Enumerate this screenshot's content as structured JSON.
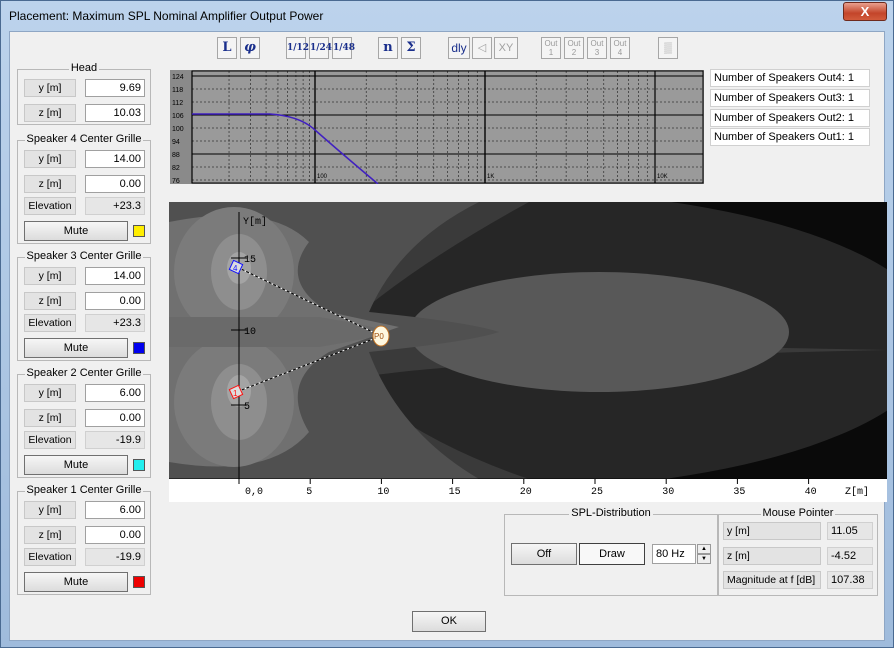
{
  "window": {
    "title": "Placement: Maximum SPL Nominal Amplifier Output Power",
    "close_label": "X"
  },
  "head": {
    "title": "Head",
    "y_label": "y [m]",
    "y_value": "9.69",
    "z_label": "z [m]",
    "z_value": "10.03"
  },
  "speakers": [
    {
      "title": "Speaker 4 Center Grille",
      "y_label": "y [m]",
      "y": "14.00",
      "z_label": "z [m]",
      "z": "0.00",
      "elev_label": "Elevation",
      "elev": "+23.3",
      "mute_label": "Mute",
      "color": "#ffee00"
    },
    {
      "title": "Speaker 3 Center Grille",
      "y_label": "y [m]",
      "y": "14.00",
      "z_label": "z [m]",
      "z": "0.00",
      "elev_label": "Elevation",
      "elev": "+23.3",
      "mute_label": "Mute",
      "color": "#0000ee"
    },
    {
      "title": "Speaker 2 Center Grille",
      "y_label": "y [m]",
      "y": "6.00",
      "z_label": "z [m]",
      "z": "0.00",
      "elev_label": "Elevation",
      "elev": "-19.9",
      "mute_label": "Mute",
      "color": "#22eeee"
    },
    {
      "title": "Speaker 1 Center Grille",
      "y_label": "y [m]",
      "y": "6.00",
      "z_label": "z [m]",
      "z": "0.00",
      "elev_label": "Elevation",
      "elev": "-19.9",
      "mute_label": "Mute",
      "color": "#ee0000"
    }
  ],
  "toolbar": {
    "L": "L",
    "phi": "φ",
    "oct12": "1/12",
    "oct24": "1/24",
    "oct48": "1/48",
    "n": "n",
    "sigma": "Σ",
    "dly": "dly",
    "speaker": "◁",
    "xy": "XY",
    "out1": "Out 1",
    "out2": "Out 2",
    "out3": "Out 3",
    "out4": "Out 4",
    "tool": "▒"
  },
  "freq_chart": {
    "y_ticks": [
      "124",
      "118",
      "112",
      "106",
      "100",
      "94",
      "88",
      "82",
      "76"
    ],
    "x_ticks": [
      "100",
      "1K",
      "10K"
    ]
  },
  "speaker_counts": [
    "Number of Speakers Out4: 1",
    "Number of Speakers Out3: 1",
    "Number of Speakers Out2: 1",
    "Number of Speakers Out1: 1"
  ],
  "plot": {
    "y_axis_label": "Y[m]",
    "z_axis_label": "Z[m]",
    "y_ticks": [
      "15",
      "10",
      "5"
    ],
    "z_ticks": [
      "0,0",
      "5",
      "10",
      "15",
      "20",
      "25",
      "30",
      "35",
      "40"
    ],
    "listener_label": "P0",
    "speaker_labels": [
      "4",
      "1"
    ]
  },
  "spl": {
    "title": "SPL-Distribution",
    "off_label": "Off",
    "draw_label": "Draw",
    "freq": "80 Hz"
  },
  "mouse": {
    "title": "Mouse Pointer",
    "y_label": "y [m]",
    "y_value": "11.05",
    "z_label": "z [m]",
    "z_value": "-4.52",
    "mag_label": "Magnitude at f [dB]",
    "mag_value": "107.38"
  },
  "ok_label": "OK"
}
